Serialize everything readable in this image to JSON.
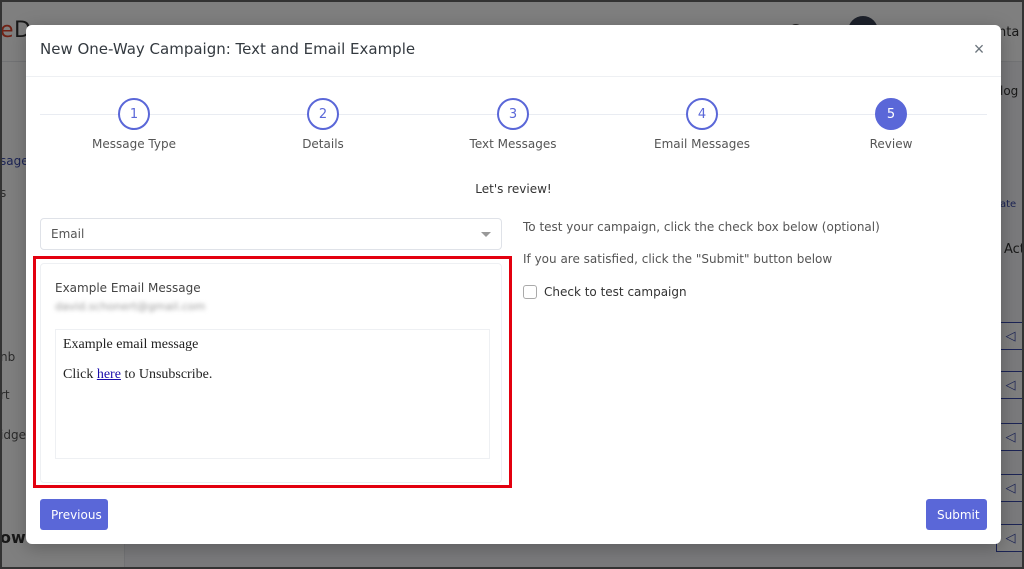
{
  "background": {
    "logo_prefix": "e",
    "logo_rest": "D",
    "top_icons": "▲ ☺",
    "user_partial": "enta",
    "sidebar_items": [
      {
        "label": "",
        "active": false
      },
      {
        "label": "sages",
        "active": true
      },
      {
        "label": "s",
        "active": false
      },
      {
        "label": "nb",
        "active": false
      },
      {
        "label": "rt",
        "active": false
      },
      {
        "label": "idge",
        "active": false
      }
    ],
    "sidebar_bottom": "ow",
    "right_texts": [
      "log",
      "ate",
      "Act"
    ],
    "send_icon": "◁"
  },
  "modal": {
    "title": "New One-Way Campaign: Text and Email Example",
    "close_icon": "×",
    "steps": [
      {
        "number": "1",
        "label": "Message Type",
        "active": false
      },
      {
        "number": "2",
        "label": "Details",
        "active": false
      },
      {
        "number": "3",
        "label": "Text Messages",
        "active": false
      },
      {
        "number": "4",
        "label": "Email Messages",
        "active": false
      },
      {
        "number": "5",
        "label": "Review",
        "active": true
      }
    ],
    "review_heading": "Let's review!",
    "message_type_select": {
      "selected": "Email"
    },
    "preview": {
      "subject": "Example Email Message",
      "recipient": "david.schonert@gmail.com",
      "body_line1": "Example email message",
      "body_click": "Click",
      "body_link": "here",
      "body_rest": "to Unsubscribe."
    },
    "info": {
      "test_instruction": "To test your campaign, click the check box below (optional)",
      "submit_instruction": "If you are satisfied, click the \"Submit\" button below",
      "checkbox_label": "Check to test campaign",
      "checkbox_checked": false
    },
    "buttons": {
      "previous": "Previous",
      "submit": "Submit"
    }
  },
  "colors": {
    "accent": "#5a67d8",
    "highlight": "#e3000f"
  }
}
